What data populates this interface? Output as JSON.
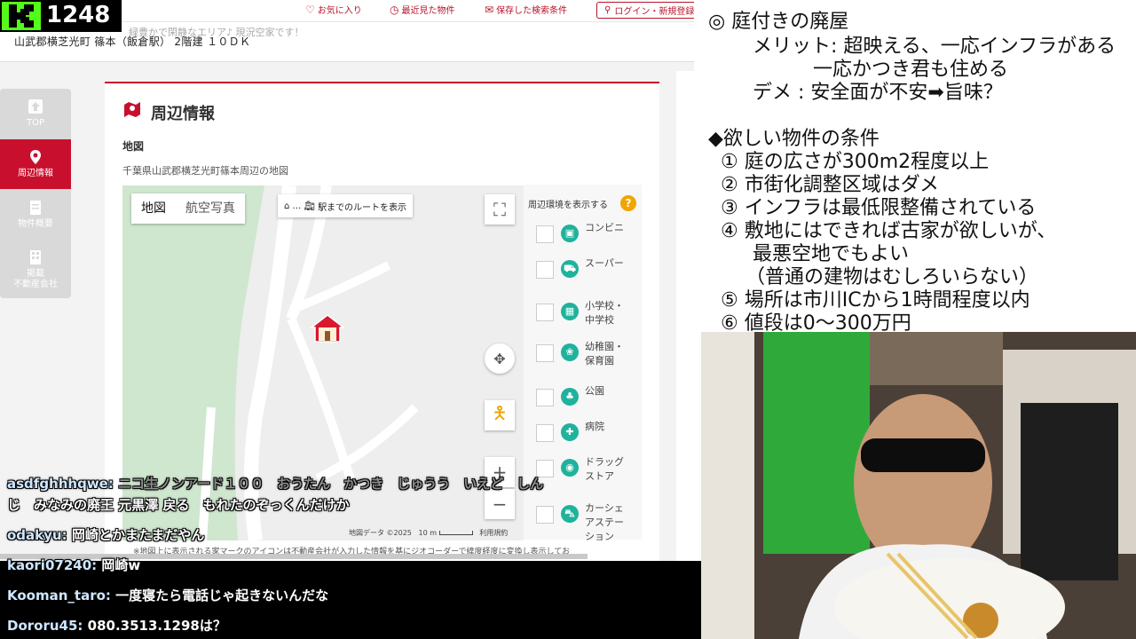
{
  "viewer_badge": {
    "count": "1248"
  },
  "site": {
    "topbar": {
      "favorites": "お気に入り",
      "recently_viewed": "最近見た物件",
      "saved_search": "保存した検索条件",
      "login": "ログイン・新規登録"
    },
    "ghost_text": "緑豊かで閑静なエリア♪ 現況空家です！",
    "address": "山武郡横芝光町 篠本（飯倉駅） 2階建 １０ＤＫ",
    "sidenav": [
      {
        "label": "TOP",
        "icon": "up-arrow-icon"
      },
      {
        "label": "周辺情報",
        "icon": "map-pin-icon"
      },
      {
        "label": "物件概要",
        "icon": "document-icon"
      },
      {
        "label": "掲載\n不動産会社",
        "icon": "building-icon"
      }
    ],
    "section_title": "周辺情報",
    "map_heading": "地図",
    "map_caption": "千葉県山武郡横芝光町篠本周辺の地図",
    "map": {
      "tab_map": "地図",
      "tab_aerial": "航空写真",
      "route_button": "駅までのルートを表示",
      "attribution": "地図データ ©2025",
      "scale": "10 m",
      "terms": "利用規約"
    },
    "poi_panel": {
      "title": "周辺環境を表示する",
      "help": "?",
      "items": [
        {
          "label": "コンビニ",
          "icon": "convenience-store-icon",
          "glyph": "▣"
        },
        {
          "label": "スーパー",
          "icon": "cart-icon",
          "glyph": "⛟"
        },
        {
          "label": "小学校・\n中学校",
          "icon": "school-icon",
          "glyph": "▦"
        },
        {
          "label": "幼稚園・\n保育園",
          "icon": "kindergarten-icon",
          "glyph": "❀"
        },
        {
          "label": "公園",
          "icon": "park-icon",
          "glyph": "♣"
        },
        {
          "label": "病院",
          "icon": "hospital-icon",
          "glyph": "✚"
        },
        {
          "label": "ドラッグ\nストア",
          "icon": "pill-icon",
          "glyph": "◉"
        },
        {
          "label": "カーシェ\nアステー\nション",
          "icon": "car-icon",
          "glyph": "⛍"
        }
      ]
    },
    "disclaimer": "※地図上に表示される家マークのアイコンは不動産会社が入力した情報を基にジオコーダーで緯度経度に変換し表示してお"
  },
  "chat": [
    {
      "user": "asdfghhhqwe:",
      "text": "ニコ生ノンアード１００　おうたん　かつき　じゅうう　いえど　しん",
      "dim": true
    },
    {
      "user": "",
      "text": "じ　みなみの廃王 元黒澤 戻る　もれたのぞっくんだけか",
      "dim": true
    },
    {
      "user": "odakyu:",
      "text": "岡崎とかまたまだやん",
      "dim": false
    },
    {
      "user": "kaori07240:",
      "text": "岡崎w",
      "dim": false
    },
    {
      "user": "Kooman_taro:",
      "text": "一度寝たら電話じゃ起きないんだな",
      "dim": false
    },
    {
      "user": "Dororu45:",
      "text": "080.3513.1298は？",
      "dim": false
    }
  ],
  "notes": {
    "line1": "◎  庭付きの廃屋",
    "line2": "メリット: 超映える、一応インフラがある",
    "line3": "一応かつき君も住める",
    "line4": "デメ  : 安全面が不安➡旨味？",
    "line5": "◆欲しい物件の条件",
    "line6": "①  庭の広さが300m2程度以上",
    "line7": "②  市街化調整区域はダメ",
    "line8": "③  インフラは最低限整備されている",
    "line9": "④  敷地にはできれば古家が欲しいが、",
    "line10": "最悪空地でもよい",
    "line11": "（普通の建物はむしろいらない）",
    "line12": "⑤  場所は市川ICから1時間程度以内",
    "line13": "⑥  値段は0～300万円"
  },
  "colors": {
    "brand_red": "#c8102e",
    "poi_teal": "#1fb29c",
    "kick_green": "#53fc18"
  }
}
